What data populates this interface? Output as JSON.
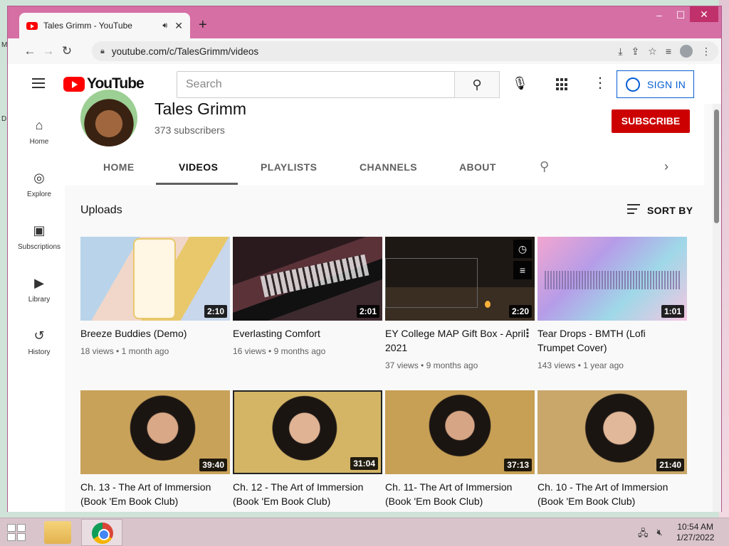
{
  "browser": {
    "tab_title": "Tales Grimm - YouTube",
    "new_tab": "+",
    "url": "youtube.com/c/TalesGrimm/videos"
  },
  "youtube": {
    "logo_text": "YouTube",
    "search_placeholder": "Search",
    "sign_in": "SIGN IN"
  },
  "guide": [
    {
      "label": "Home",
      "icon": "home-icon",
      "glyph": "⌂"
    },
    {
      "label": "Explore",
      "icon": "compass-icon",
      "glyph": "◎"
    },
    {
      "label": "Subscriptions",
      "icon": "subscriptions-icon",
      "glyph": "▣"
    },
    {
      "label": "Library",
      "icon": "library-icon",
      "glyph": "▶"
    },
    {
      "label": "History",
      "icon": "history-icon",
      "glyph": "↺"
    }
  ],
  "channel": {
    "name": "Tales Grimm",
    "subscribers": "373 subscribers",
    "subscribe": "SUBSCRIBE",
    "tabs": [
      "HOME",
      "VIDEOS",
      "PLAYLISTS",
      "CHANNELS",
      "ABOUT"
    ],
    "active_tab": "VIDEOS"
  },
  "content": {
    "section_title": "Uploads",
    "sort_label": "SORT BY"
  },
  "videos": [
    {
      "title": "Breeze Buddies (Demo)",
      "views": "18 views",
      "age": "1 month ago",
      "duration": "2:10"
    },
    {
      "title": "Everlasting Comfort",
      "views": "16 views",
      "age": "9 months ago",
      "duration": "2:01"
    },
    {
      "title": "EY College MAP Gift Box - April 2021",
      "views": "37 views",
      "age": "9 months ago",
      "duration": "2:20"
    },
    {
      "title": "Tear Drops - BMTH (Lofi Trumpet Cover)",
      "views": "143 views",
      "age": "1 year ago",
      "duration": "1:01"
    },
    {
      "title": "Ch. 13 - The Art of Immersion (Book 'Em Book Club)",
      "duration": "39:40"
    },
    {
      "title": "Ch. 12 - The Art of Immersion (Book 'Em Book Club)",
      "duration": "31:04"
    },
    {
      "title": "Ch. 11- The Art of Immersion (Book 'Em Book Club)",
      "duration": "37:13"
    },
    {
      "title": "Ch. 10 - The Art of Immersion (Book 'Em Book Club)",
      "duration": "21:40"
    }
  ],
  "taskbar": {
    "time": "10:54 AM",
    "date": "1/27/2022"
  },
  "colors": {
    "window_frame": "#d56fa4",
    "youtube_red": "#ff0000",
    "subscribe_red": "#cc0000",
    "signin_blue": "#065fd4"
  }
}
